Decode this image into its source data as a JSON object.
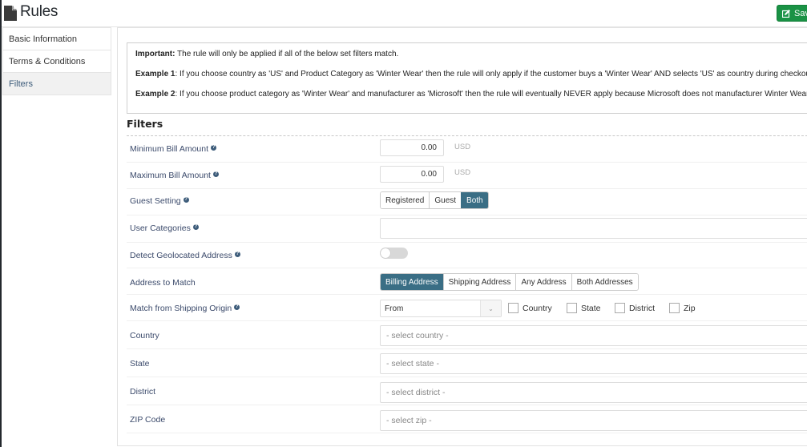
{
  "header": {
    "title": "Rules",
    "save_label": "Save"
  },
  "sidebar": {
    "items": [
      {
        "label": "Basic Information",
        "active": false
      },
      {
        "label": "Terms & Conditions",
        "active": false
      },
      {
        "label": "Filters",
        "active": true
      }
    ]
  },
  "notice": {
    "important_label": "Important:",
    "important_text": " The rule will only be applied if all of the below set filters match.",
    "example1_label": "Example 1",
    "example1_text": ": If you choose country as 'US' and Product Category as 'Winter Wear' then the rule will only apply if the customer buys a 'Winter Wear' AND selects 'US' as country during checkout.",
    "example2_label": "Example 2",
    "example2_text": ": If you choose product category as 'Winter Wear' and manufacturer as 'Microsoft' then the rule will eventually NEVER apply because Microsoft does not manufacturer Winter Wears."
  },
  "filters": {
    "heading": "Filters",
    "help_glyph": "?",
    "min_bill": {
      "label": "Minimum Bill Amount",
      "value": "0.00",
      "currency": "USD"
    },
    "max_bill": {
      "label": "Maximum Bill Amount",
      "value": "0.00",
      "currency": "USD"
    },
    "guest_setting": {
      "label": "Guest Setting",
      "options": [
        "Registered",
        "Guest",
        "Both"
      ],
      "selected": "Both"
    },
    "user_categories": {
      "label": "User Categories",
      "value": ""
    },
    "detect_geo": {
      "label": "Detect Geolocated Address",
      "enabled": false
    },
    "address_match": {
      "label": "Address to Match",
      "options": [
        "Billing Address",
        "Shipping Address",
        "Any Address",
        "Both Addresses"
      ],
      "selected": "Billing Address"
    },
    "shipping_origin": {
      "label": "Match from Shipping Origin",
      "select_value": "From",
      "chevron_glyph": "⌄",
      "checkboxes": [
        {
          "label": "Country",
          "checked": false
        },
        {
          "label": "State",
          "checked": false
        },
        {
          "label": "District",
          "checked": false
        },
        {
          "label": "Zip",
          "checked": false
        }
      ]
    },
    "country": {
      "label": "Country",
      "placeholder": "- select country -"
    },
    "state": {
      "label": "State",
      "placeholder": "- select state -"
    },
    "district": {
      "label": "District",
      "placeholder": "- select district -"
    },
    "zip": {
      "label": "ZIP Code",
      "placeholder": "- select zip -"
    }
  },
  "colors": {
    "accent": "#3a6e85",
    "save_button": "#1a9245",
    "label_text": "#3b4a6b"
  }
}
